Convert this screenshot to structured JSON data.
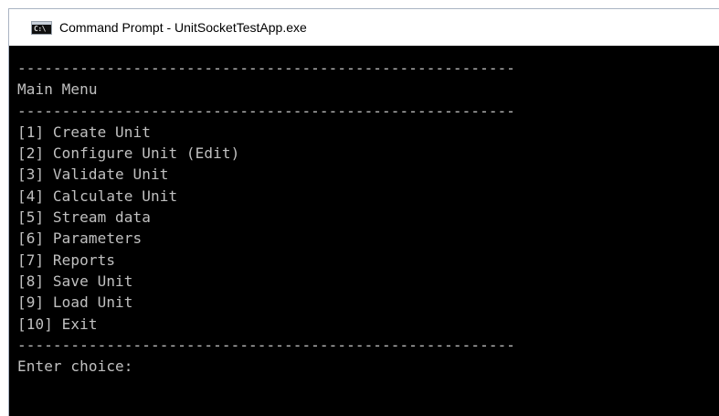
{
  "window": {
    "title": "Command Prompt - UnitSocketTestApp.exe",
    "icon": "command-prompt-icon",
    "icon_glyph": "C:\\"
  },
  "console": {
    "separator": "--------------------------------------------------------",
    "heading": "Main Menu",
    "menu_items": [
      "[1] Create Unit",
      "[2] Configure Unit (Edit)",
      "[3] Validate Unit",
      "[4] Calculate Unit",
      "[5] Stream data",
      "[6] Parameters",
      "[7] Reports",
      "[8] Save Unit",
      "[9] Load Unit",
      "[10] Exit"
    ],
    "prompt": "Enter choice:"
  },
  "colors": {
    "console_background": "#000000",
    "console_text": "#c0c0c0",
    "titlebar_background": "#ffffff"
  }
}
